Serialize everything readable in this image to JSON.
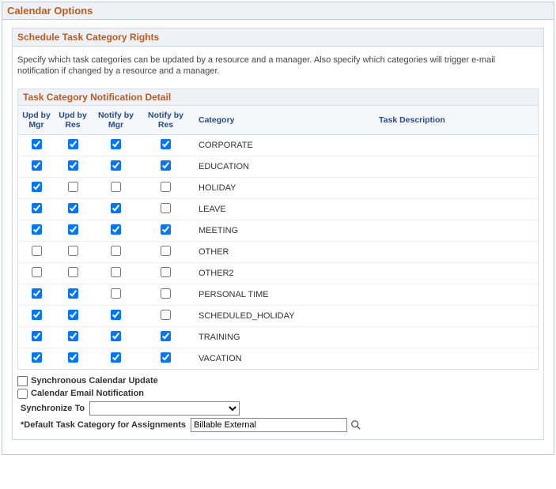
{
  "outer_title": "Calendar Options",
  "sub_title": "Schedule Task Category Rights",
  "description": "Specify which task categories can be updated by a resource and a manager. Also specify which categories will trigger e-mail notification if changed by a resource and a manager.",
  "table_title": "Task Category Notification Detail",
  "columns": {
    "upd_by_mgr": "Upd by Mgr",
    "upd_by_res": "Upd by Res",
    "notify_by_mgr": "Notify by Mgr",
    "notify_by_res": "Notify by Res",
    "category": "Category",
    "task_description": "Task Description"
  },
  "rows": [
    {
      "upd_mgr": true,
      "upd_res": true,
      "not_mgr": true,
      "not_res": true,
      "category": "CORPORATE",
      "desc": ""
    },
    {
      "upd_mgr": true,
      "upd_res": true,
      "not_mgr": true,
      "not_res": true,
      "category": "EDUCATION",
      "desc": ""
    },
    {
      "upd_mgr": true,
      "upd_res": false,
      "not_mgr": false,
      "not_res": false,
      "category": "HOLIDAY",
      "desc": ""
    },
    {
      "upd_mgr": true,
      "upd_res": true,
      "not_mgr": true,
      "not_res": false,
      "category": "LEAVE",
      "desc": ""
    },
    {
      "upd_mgr": true,
      "upd_res": true,
      "not_mgr": true,
      "not_res": true,
      "category": "MEETING",
      "desc": ""
    },
    {
      "upd_mgr": false,
      "upd_res": false,
      "not_mgr": false,
      "not_res": false,
      "category": "OTHER",
      "desc": ""
    },
    {
      "upd_mgr": false,
      "upd_res": false,
      "not_mgr": false,
      "not_res": false,
      "category": "OTHER2",
      "desc": ""
    },
    {
      "upd_mgr": true,
      "upd_res": true,
      "not_mgr": false,
      "not_res": false,
      "category": "PERSONAL TIME",
      "desc": ""
    },
    {
      "upd_mgr": true,
      "upd_res": true,
      "not_mgr": true,
      "not_res": false,
      "category": "SCHEDULED_HOLIDAY",
      "desc": ""
    },
    {
      "upd_mgr": true,
      "upd_res": true,
      "not_mgr": true,
      "not_res": true,
      "category": "TRAINING",
      "desc": ""
    },
    {
      "upd_mgr": true,
      "upd_res": true,
      "not_mgr": true,
      "not_res": true,
      "category": "VACATION",
      "desc": ""
    }
  ],
  "footer": {
    "sync_update_label": "Synchronous Calendar Update",
    "sync_update_checked": false,
    "email_notif_label": "Calendar Email Notification",
    "email_notif_checked": false,
    "sync_to_label": "Synchronize To",
    "sync_to_value": "",
    "default_cat_label": "*Default Task Category for Assignments",
    "default_cat_value": "Billable External"
  }
}
